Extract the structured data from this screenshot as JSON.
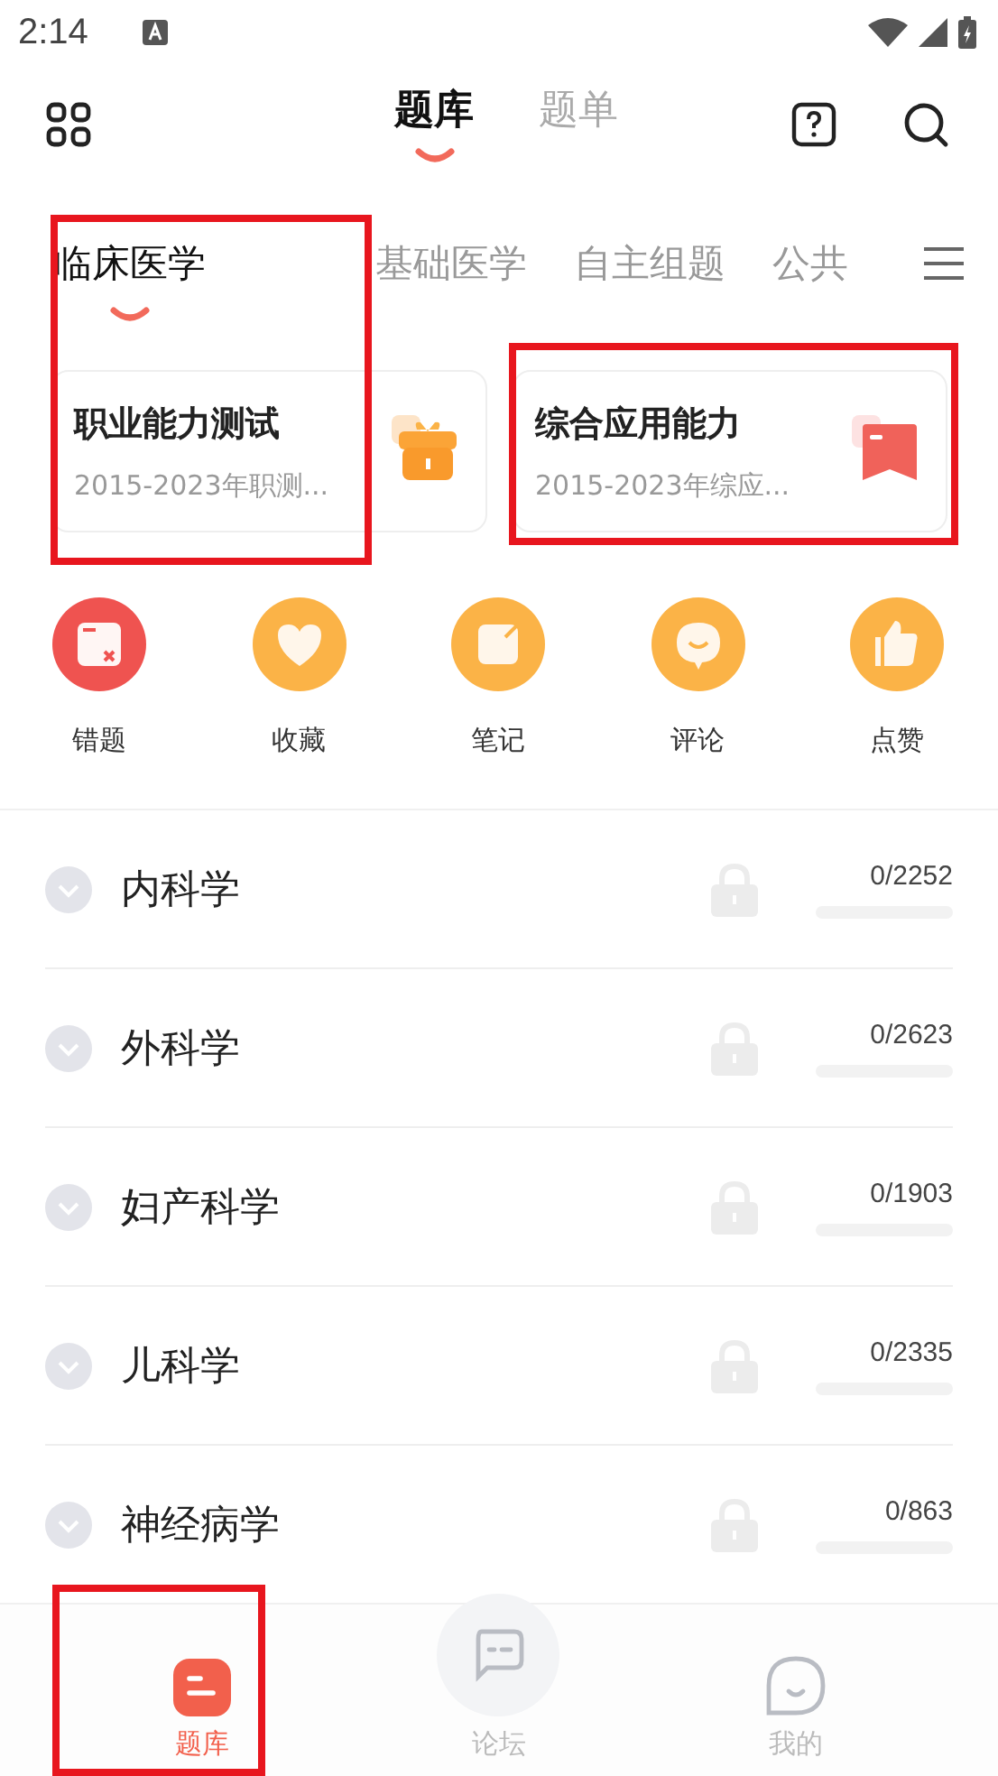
{
  "status_bar": {
    "time": "2:14"
  },
  "header_tabs": [
    {
      "label": "题库",
      "selected": true
    },
    {
      "label": "题单",
      "selected": false
    }
  ],
  "category_tabs": [
    {
      "label": "临床医学",
      "selected": true
    },
    {
      "label": "基础医学",
      "selected": false
    },
    {
      "label": "自主组题",
      "selected": false
    },
    {
      "label": "公共",
      "selected": false
    }
  ],
  "cards": [
    {
      "title": "职业能力测试",
      "subtitle": "2015-2023年职测...",
      "kind": "gift"
    },
    {
      "title": "综合应用能力",
      "subtitle": "2015-2023年综应...",
      "kind": "bookmark"
    }
  ],
  "shortcuts": [
    {
      "label": "错题",
      "kind": "wrong",
      "color": "#ef5350"
    },
    {
      "label": "收藏",
      "kind": "heart",
      "color": "#fbb347"
    },
    {
      "label": "笔记",
      "kind": "note",
      "color": "#fbb347"
    },
    {
      "label": "评论",
      "kind": "comment",
      "color": "#fbb347"
    },
    {
      "label": "点赞",
      "kind": "like",
      "color": "#fbb347"
    }
  ],
  "subjects": [
    {
      "name": "内科学",
      "count": "0/2252",
      "locked": true
    },
    {
      "name": "外科学",
      "count": "0/2623",
      "locked": true
    },
    {
      "name": "妇产科学",
      "count": "0/1903",
      "locked": true
    },
    {
      "name": "儿科学",
      "count": "0/2335",
      "locked": true
    },
    {
      "name": "神经病学",
      "count": "0/863",
      "locked": true
    }
  ],
  "bottom_nav": [
    {
      "label": "题库",
      "kind": "bank",
      "selected": true
    },
    {
      "label": "论坛",
      "kind": "forum",
      "selected": false
    },
    {
      "label": "我的",
      "kind": "me",
      "selected": false
    }
  ]
}
